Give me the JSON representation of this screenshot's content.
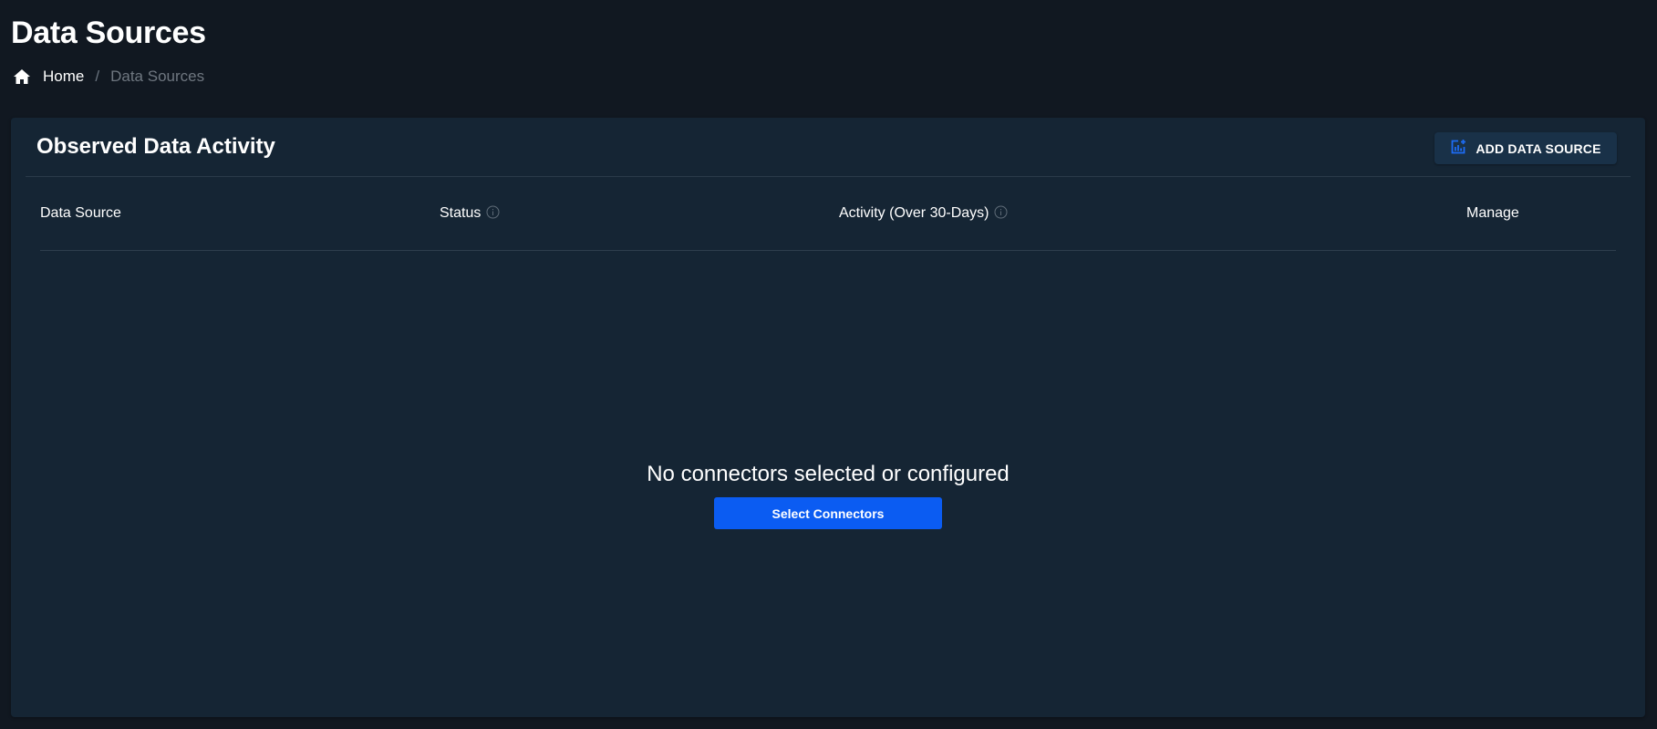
{
  "page": {
    "title": "Data Sources"
  },
  "breadcrumb": {
    "home_label": "Home",
    "separator": "/",
    "current_label": "Data Sources"
  },
  "card": {
    "title": "Observed Data Activity",
    "add_button_label": "ADD DATA SOURCE"
  },
  "table": {
    "columns": [
      {
        "label": "Data Source"
      },
      {
        "label": "Status"
      },
      {
        "label": "Activity (Over 30-Days)"
      },
      {
        "label": "Manage"
      }
    ]
  },
  "empty_state": {
    "message": "No connectors selected or configured",
    "button_label": "Select Connectors"
  },
  "icons": {
    "home": "home-icon",
    "add_data_source": "add-chart-icon",
    "info": "info-icon"
  },
  "colors": {
    "background": "#111821",
    "card": "#152534",
    "primary_button": "#0b5cf2",
    "secondary_button": "#193148",
    "muted_text": "#6f7780"
  }
}
